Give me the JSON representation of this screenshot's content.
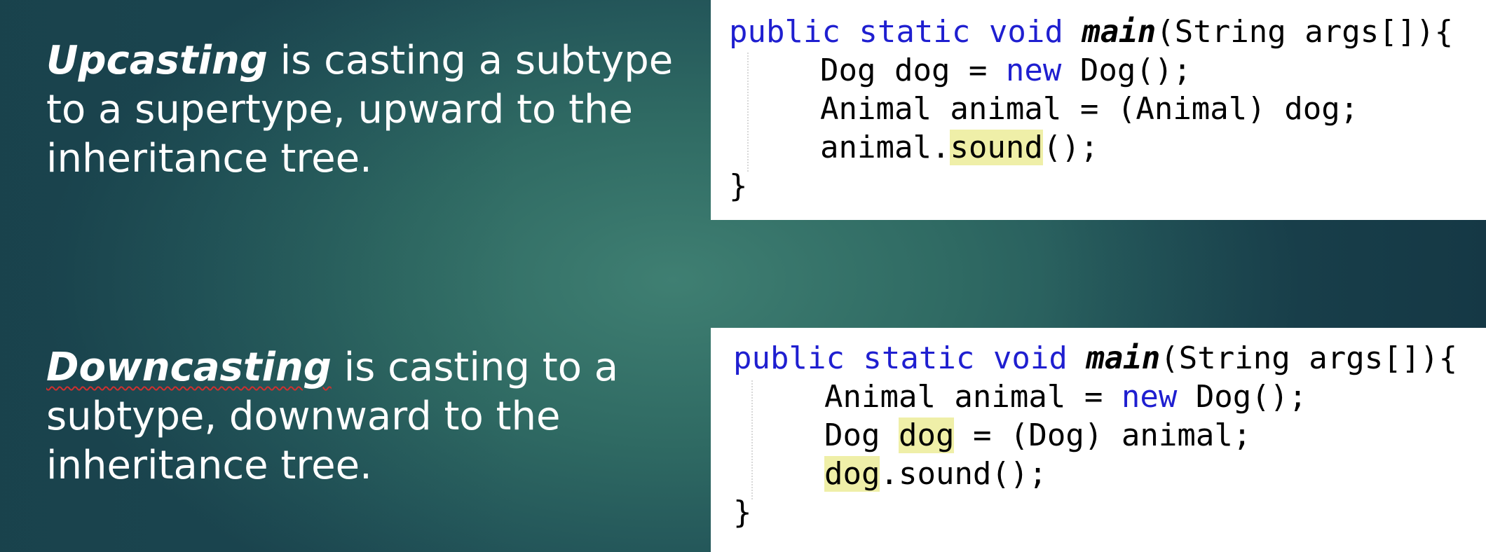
{
  "upcasting": {
    "term": "Upcasting",
    "line1_rest": " is casting a subtype",
    "line2": "to a supertype, upward to the",
    "line3": "inheritance tree."
  },
  "downcasting": {
    "term": "Downcasting",
    "line1_rest": " is casting to a",
    "line2": "subtype, downward to the",
    "line3": "inheritance tree."
  },
  "code_upcast": {
    "sig_kw": "public static void ",
    "sig_fn": "main",
    "sig_rest": "(String args[]){",
    "l2_a": "Dog dog = ",
    "l2_kw": "new",
    "l2_b": " Dog();",
    "l3": "Animal animal = (Animal) dog;",
    "l4_a": "animal.",
    "l4_hl": "sound",
    "l4_b": "();",
    "close": "}"
  },
  "code_downcast": {
    "sig_kw": "public static void ",
    "sig_fn": "main",
    "sig_rest": "(String args[]){",
    "l2_a": "Animal animal = ",
    "l2_kw": "new",
    "l2_b": " Dog();",
    "l3_a": "Dog ",
    "l3_hl": "dog",
    "l3_b": " = (Dog) animal;",
    "l4_hl": "dog",
    "l4_b": ".sound();",
    "close": "}"
  },
  "colors": {
    "keyword": "#1f1fd0",
    "highlight": "#efefa8",
    "background": "#2f6a63"
  }
}
